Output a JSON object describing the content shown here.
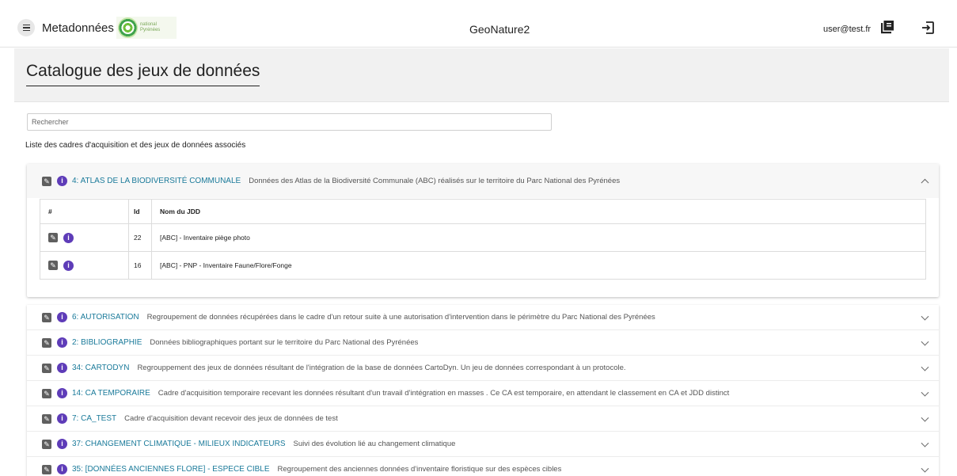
{
  "toolbar": {
    "app_name": "Metadonnées",
    "logo_text": "national Pyrénées",
    "title": "GeoNature2",
    "user": "user@test.fr"
  },
  "page": {
    "title": "Catalogue des jeux de données",
    "search_placeholder": "Rechercher",
    "list_label": "Liste des cadres d'acquisition et des jeux de données associés"
  },
  "expanded": {
    "name": "4: ATLAS DE LA BIODIVERSITÉ COMMUNALE",
    "description": "Données des Atlas de la Biodiversité Communale (ABC) réalisés sur le territoire du Parc National des Pyrénées",
    "table": {
      "headers": [
        "#",
        "Id",
        "Nom du JDD"
      ],
      "rows": [
        {
          "id": "22",
          "name": "[ABC] - Inventaire piège photo"
        },
        {
          "id": "16",
          "name": "[ABC] - PNP - Inventaire Faune/Flore/Fonge"
        }
      ]
    }
  },
  "collapsed": [
    {
      "name": "6: AUTORISATION",
      "description": "Regroupement de données récupérées dans le cadre d'un retour suite à une autorisation d'intervention dans le périmètre du Parc National des Pyrénées"
    },
    {
      "name": "2: BIBLIOGRAPHIE",
      "description": "Données bibliographiques portant sur le territoire du Parc National des Pyrénées"
    },
    {
      "name": "34: CARTODYN",
      "description": "Regrouppement des jeux de données résultant de l'intégration de la base de données CartoDyn. Un jeu de données correspondant à un protocole."
    },
    {
      "name": "14: CA TEMPORAIRE",
      "description": "Cadre d'acquisition temporaire recevant les données résultant d'un travail d'intégration en masses . Ce CA est temporaire, en attendant le classement en CA et JDD distinct"
    },
    {
      "name": "7: CA_TEST",
      "description": "Cadre d'acquisition devant recevoir des jeux de données de test"
    },
    {
      "name": "37: CHANGEMENT CLIMATIQUE - MILIEUX INDICATEURS",
      "description": "Suivi des évolution lié au changement climatique"
    },
    {
      "name": "35: [DONNÉES ANCIENNES FLORE] - ESPECE CIBLE",
      "description": "Regroupement des anciennes données d'inventaire floristique sur des espèces cibles"
    }
  ],
  "icons": {
    "menu": "menu-icon",
    "book": "library-books-icon",
    "logout": "logout-icon",
    "edit": "edit-icon",
    "info": "info-icon",
    "expand": "chevron-down-icon",
    "collapse": "chevron-up-icon"
  },
  "colors": {
    "link": "#1a7a9a",
    "info": "#5e3cb8",
    "edit": "#5f5f5f"
  }
}
